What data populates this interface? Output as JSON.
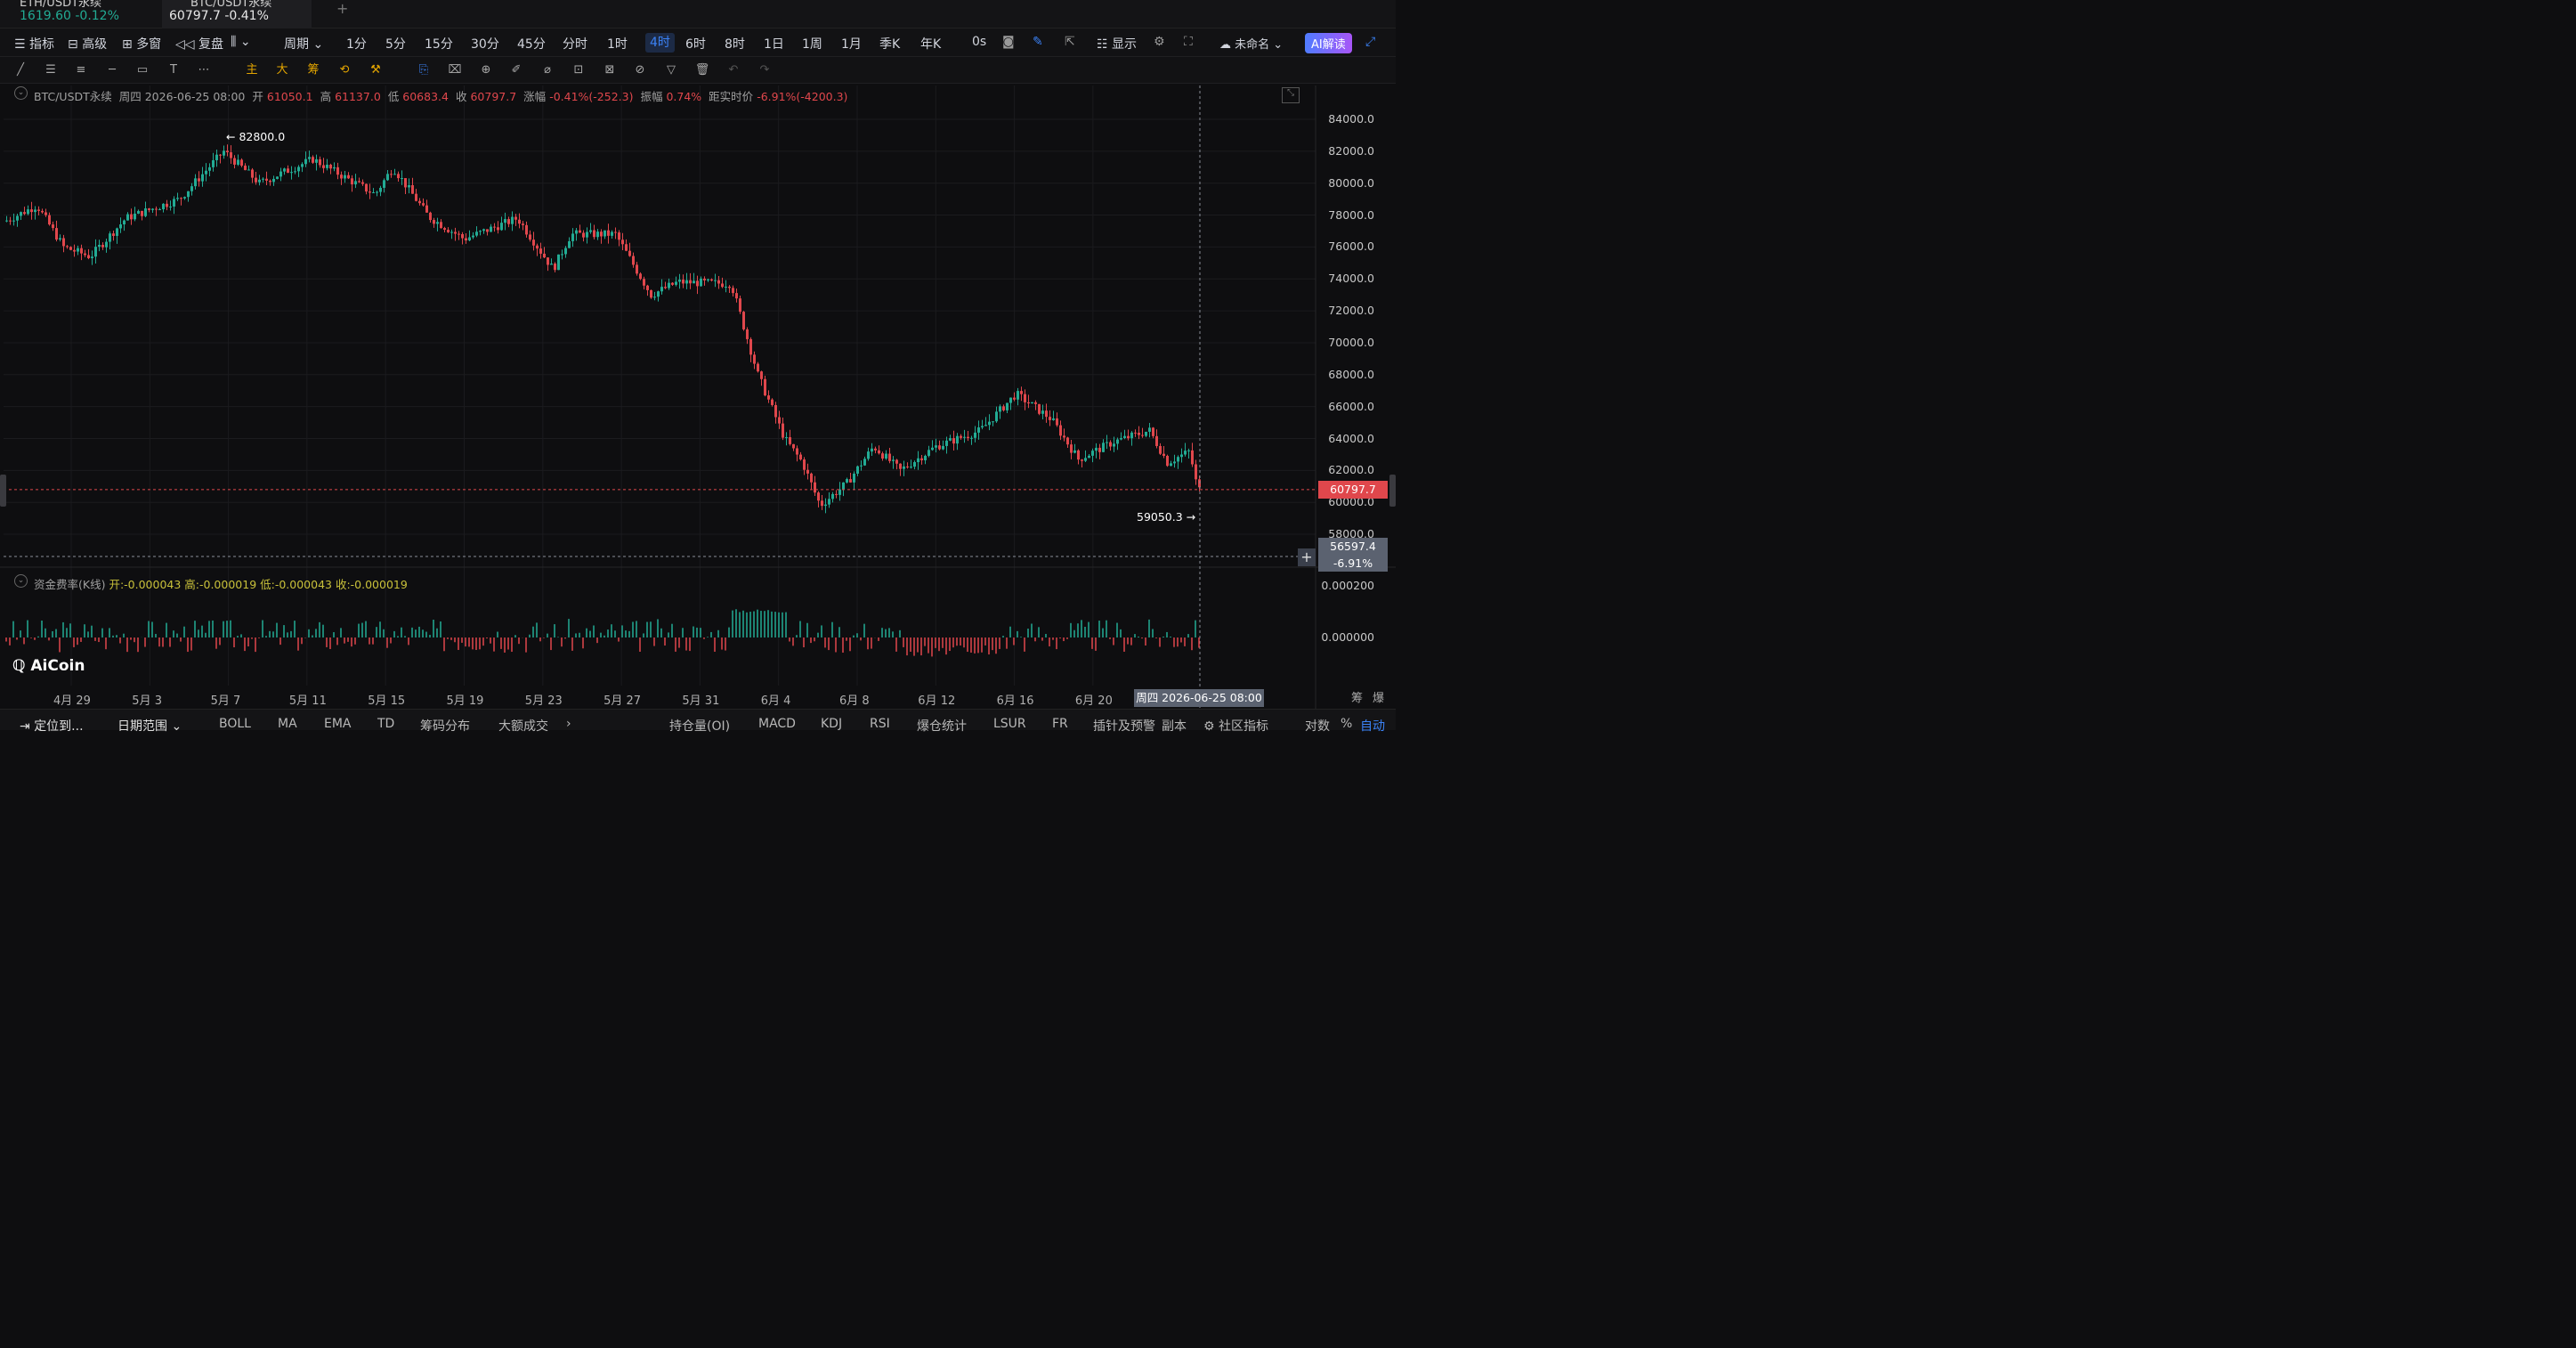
{
  "tabs": [
    {
      "name": "ETH/USDT永续",
      "price": "1619.60",
      "change": "-0.12%"
    },
    {
      "name": "BTC/USDT永续",
      "price": "60797.7",
      "change": "-0.41%"
    }
  ],
  "toolbar": {
    "indicators": "指标",
    "advanced": "高级",
    "multi": "多窗",
    "replay": "复盘",
    "period": "周期",
    "periods": [
      "1分",
      "5分",
      "15分",
      "30分",
      "45分",
      "分时",
      "1时",
      "4时",
      "6时",
      "8时",
      "1日",
      "1周",
      "1月",
      "季K",
      "年K"
    ],
    "selected_period": "4时",
    "countdown": "0s",
    "display": "显示",
    "unnamed": "未命名",
    "ai": "AI解读"
  },
  "drawbar": {
    "main": "主",
    "big": "大",
    "chip": "筹"
  },
  "ohlc": {
    "symbol": "BTC/USDT永续",
    "date": "周四 2026-06-25 08:00",
    "open_label": "开",
    "open": "61050.1",
    "high_label": "高",
    "high": "61137.0",
    "low_label": "低",
    "low": "60683.4",
    "close_label": "收",
    "close": "60797.7",
    "chg_label": "涨幅",
    "chg": "-0.41%(-252.3)",
    "amp_label": "振幅",
    "amp": "0.74%",
    "dist_label": "距实时价",
    "dist": "-6.91%(-4200.3)"
  },
  "price_axis": [
    "84000.0",
    "82000.0",
    "80000.0",
    "78000.0",
    "76000.0",
    "74000.0",
    "72000.0",
    "70000.0",
    "68000.0",
    "66000.0",
    "64000.0",
    "62000.0",
    "60000.0",
    "58000.0"
  ],
  "last_price_tag": "60797.7",
  "cursor_price": "56597.4",
  "cursor_pct": "-6.91%",
  "high_mark": "82800.0",
  "low_mark": "59050.3",
  "funding": {
    "title": "资金费率(K线)",
    "values": "开:-0.000043 高:-0.000019 低:-0.000043 收:-0.000019",
    "axis": [
      "0.000200",
      "0.000000"
    ]
  },
  "x_axis": [
    "4月 29",
    "5月 3",
    "5月 7",
    "5月 11",
    "5月 15",
    "5月 19",
    "5月 23",
    "5月 27",
    "5月 31",
    "6月 4",
    "6月 8",
    "6月 12",
    "6月 16",
    "6月 20"
  ],
  "cursor_time": "周四 2026-06-25 08:00",
  "logo": "AiCoin",
  "bottom": {
    "locate": "定位到...",
    "range": "日期范围",
    "indicators": [
      "BOLL",
      "MA",
      "EMA",
      "TD",
      "筹码分布",
      "大额成交"
    ],
    "indicators2": [
      "持仓量(OI)",
      "MACD",
      "KDJ",
      "RSI",
      "爆仓统计",
      "LSUR",
      "FR",
      "插针及预警",
      "副本"
    ],
    "community": "社区指标",
    "log": "对数",
    "pct": "%",
    "auto": "自动",
    "right_chips": [
      "筹",
      "爆"
    ]
  },
  "colors": {
    "up": "#22ab94",
    "down": "#e0474c",
    "accent": "#3b82f6"
  }
}
